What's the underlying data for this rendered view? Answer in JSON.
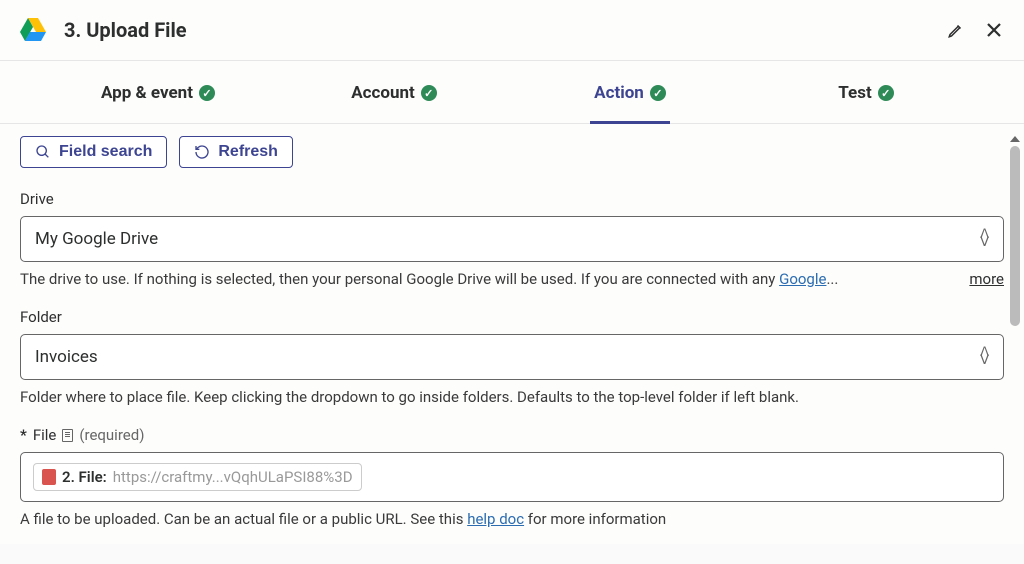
{
  "header": {
    "title": "3. Upload File"
  },
  "tabs": [
    {
      "label": "App & event",
      "active": false
    },
    {
      "label": "Account",
      "active": false
    },
    {
      "label": "Action",
      "active": true
    },
    {
      "label": "Test",
      "active": false
    }
  ],
  "toolbar": {
    "field_search": "Field search",
    "refresh": "Refresh"
  },
  "fields": {
    "drive": {
      "label": "Drive",
      "value": "My Google Drive",
      "help_prefix": "The drive to use. If nothing is selected, then your personal Google Drive will be used. If you are connected with any ",
      "help_link": "Google",
      "help_suffix": "...",
      "more": "more"
    },
    "folder": {
      "label": "Folder",
      "value": "Invoices",
      "help": "Folder where to place file. Keep clicking the dropdown to go inside folders. Defaults to the top-level folder if left blank."
    },
    "file": {
      "req": "*",
      "label": "File",
      "annot": "(required)",
      "token_label": "2. File:",
      "token_value": "https://craftmy...vQqhULaPSI88%3D",
      "help_prefix": "A file to be uploaded. Can be an actual file or a public URL. See this ",
      "help_link": "help doc",
      "help_suffix": " for more information"
    }
  }
}
